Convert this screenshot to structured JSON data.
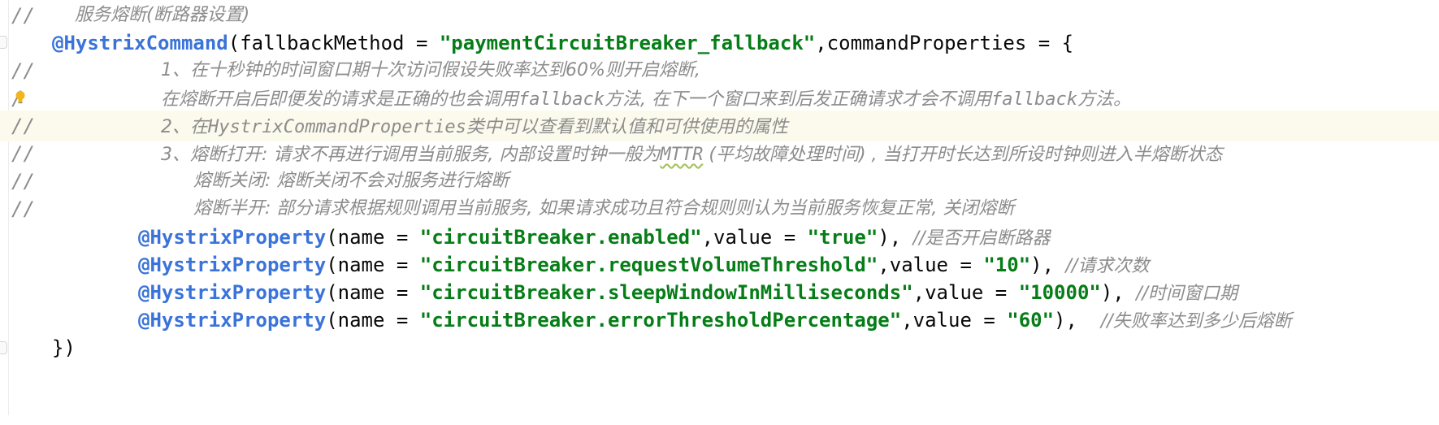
{
  "editor": {
    "lines": [
      {
        "slashes": "//",
        "comment": "服务熔断(断路器设置)"
      },
      {
        "annotation": "@HystrixCommand",
        "open": "(fallbackMethod = ",
        "string": "\"paymentCircuitBreaker_fallback\"",
        "rest": ",commandProperties = {"
      },
      {
        "slashes": "//",
        "comment": "1、在十秒钟的时间窗口期十次访问假设失败率达到60%则开启熔断,"
      },
      {
        "slashes": "/",
        "comment_pre": "在熔断开启后即便发的请求是正确的也会调用",
        "comment_mono1": "fallback",
        "comment_mid": "方法, 在下一个窗口来到后发正确请求才会不调用",
        "comment_mono2": "fallback",
        "comment_post": "方法。"
      },
      {
        "slashes": "//",
        "comment_pre": "2、在",
        "comment_mono": "HystrixCommandProperties",
        "comment_post": "类中可以查看到默认值和可供使用的属性"
      },
      {
        "slashes": "//",
        "comment_pre": "3、熔断打开: 请求不再进行调用当前服务, 内部设置时钟一般为",
        "comment_mono": "MTTR",
        "comment_post": " (平均故障处理时间) , 当打开时长达到所设时钟则进入半熔断状态"
      },
      {
        "slashes": "//",
        "comment": "熔断关闭: 熔断关闭不会对服务进行熔断"
      },
      {
        "slashes": "//",
        "comment": "熔断半开: 部分请求根据规则调用当前服务, 如果请求成功且符合规则则认为当前服务恢复正常, 关闭熔断"
      },
      {
        "annotation": "@HystrixProperty",
        "open": "(name = ",
        "name": "\"circuitBreaker.enabled\"",
        "mid": ",value = ",
        "value": "\"true\"",
        "close": "), ",
        "trail": "//是否开启断路器"
      },
      {
        "annotation": "@HystrixProperty",
        "open": "(name = ",
        "name": "\"circuitBreaker.requestVolumeThreshold\"",
        "mid": ",value = ",
        "value": "\"10\"",
        "close": "), ",
        "trail": "//请求次数"
      },
      {
        "annotation": "@HystrixProperty",
        "open": "(name = ",
        "name": "\"circuitBreaker.sleepWindowInMilliseconds\"",
        "mid": ",value = ",
        "value": "\"10000\"",
        "close": "), ",
        "trail": "//时间窗口期"
      },
      {
        "annotation": "@HystrixProperty",
        "open": "(name = ",
        "name": "\"circuitBreaker.errorThresholdPercentage\"",
        "mid": ",value = ",
        "value": "\"60\"",
        "close": "),  ",
        "trail": "//失败率达到多少后熔断"
      },
      {
        "code": "})"
      }
    ]
  },
  "colors": {
    "annotation": "#3a73d9",
    "string": "#067d17",
    "comment": "#8c8c8c",
    "current_line": "#fcfaed"
  },
  "icons": {
    "intention": "lightbulb-icon"
  }
}
